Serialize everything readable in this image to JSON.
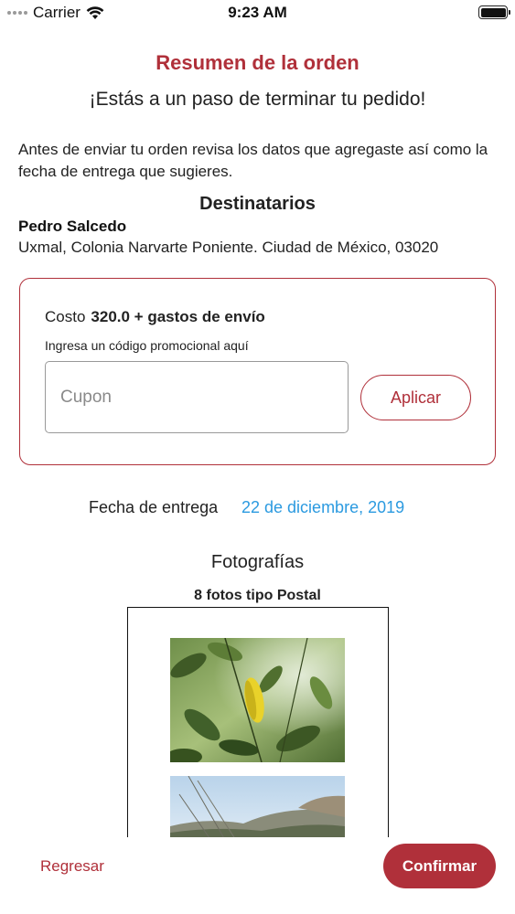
{
  "status_bar": {
    "carrier": "Carrier",
    "time": "9:23 AM",
    "signal_icon": "signal-dots-icon",
    "wifi_icon": "wifi-icon",
    "battery_icon": "battery-icon"
  },
  "header": {
    "title": "Resumen de la orden",
    "subtitle": "¡Estás a un paso de terminar tu pedido!"
  },
  "intro_text": "Antes de enviar tu orden revisa los datos que agregaste así como la fecha de entrega que sugieres.",
  "recipients": {
    "title": "Destinatarios",
    "name": "Pedro Salcedo",
    "address": "Uxmal, Colonia Narvarte Poniente. Ciudad de México, 03020"
  },
  "cost": {
    "label": "Costo",
    "amount": "320.0 + gastos de envío",
    "promo_label": "Ingresa un código promocional aquí",
    "coupon_placeholder": "Cupon",
    "coupon_value": "",
    "apply_label": "Aplicar"
  },
  "delivery": {
    "label": "Fecha de entrega",
    "date": "22 de diciembre, 2019"
  },
  "photos": {
    "title": "Fotografías",
    "type": "8 fotos tipo Postal"
  },
  "footer": {
    "back_label": "Regresar",
    "confirm_label": "Confirmar"
  },
  "colors": {
    "accent": "#b0303a",
    "link": "#2b9ae0"
  }
}
